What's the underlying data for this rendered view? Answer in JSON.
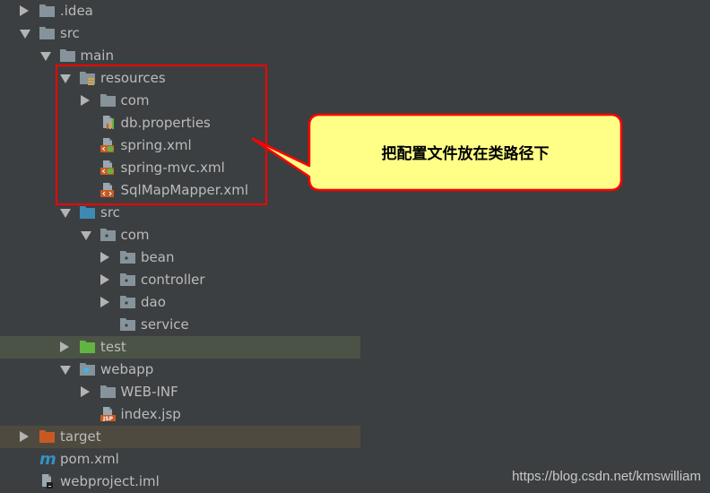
{
  "tree": {
    "rows": [
      {
        "label": ".idea",
        "level": 0,
        "arrow": "closed",
        "icon": "folder"
      },
      {
        "label": "src",
        "level": 0,
        "arrow": "open",
        "icon": "folder"
      },
      {
        "label": "main",
        "level": 1,
        "arrow": "open",
        "icon": "folder"
      },
      {
        "label": "resources",
        "level": 2,
        "arrow": "open",
        "icon": "resources-folder"
      },
      {
        "label": "com",
        "level": 3,
        "arrow": "closed",
        "icon": "folder"
      },
      {
        "label": "db.properties",
        "level": 3,
        "arrow": "none",
        "icon": "properties-file"
      },
      {
        "label": "spring.xml",
        "level": 3,
        "arrow": "none",
        "icon": "spring-xml-file"
      },
      {
        "label": "spring-mvc.xml",
        "level": 3,
        "arrow": "none",
        "icon": "spring-xml-file"
      },
      {
        "label": "SqlMapMapper.xml",
        "level": 3,
        "arrow": "none",
        "icon": "xml-file"
      },
      {
        "label": "src",
        "level": 2,
        "arrow": "open",
        "icon": "source-folder"
      },
      {
        "label": "com",
        "level": 3,
        "arrow": "open",
        "icon": "package"
      },
      {
        "label": "bean",
        "level": 4,
        "arrow": "closed",
        "icon": "package"
      },
      {
        "label": "controller",
        "level": 4,
        "arrow": "closed",
        "icon": "package"
      },
      {
        "label": "dao",
        "level": 4,
        "arrow": "closed",
        "icon": "package"
      },
      {
        "label": "service",
        "level": 4,
        "arrow": "none",
        "icon": "package"
      },
      {
        "label": "test",
        "level": 2,
        "arrow": "closed",
        "icon": "test-folder",
        "highlight": "green"
      },
      {
        "label": "webapp",
        "level": 2,
        "arrow": "open",
        "icon": "web-folder"
      },
      {
        "label": "WEB-INF",
        "level": 3,
        "arrow": "closed",
        "icon": "folder"
      },
      {
        "label": "index.jsp",
        "level": 3,
        "arrow": "none",
        "icon": "jsp-file"
      },
      {
        "label": "target",
        "level": 0,
        "arrow": "closed",
        "icon": "excluded-folder",
        "highlight": "brown"
      },
      {
        "label": "pom.xml",
        "level": 0,
        "arrow": "none",
        "icon": "maven-file"
      },
      {
        "label": "webproject.iml",
        "level": 0,
        "arrow": "none",
        "icon": "iml-file"
      }
    ]
  },
  "annotation": {
    "callout_text": "把配置文件放在类路径下",
    "box_color": "#ff0000",
    "bubble_fill": "#ffff88"
  },
  "colors": {
    "background": "#3c3f41",
    "text": "#bbbbbb",
    "folder": "#87939a",
    "source_folder": "#3d8ab3",
    "test_folder": "#62b543",
    "excluded_folder": "#c75a23",
    "file_badge": "#c75a23",
    "maven": "#3592c4"
  },
  "watermark": "https://blog.csdn.net/kmswilliam"
}
